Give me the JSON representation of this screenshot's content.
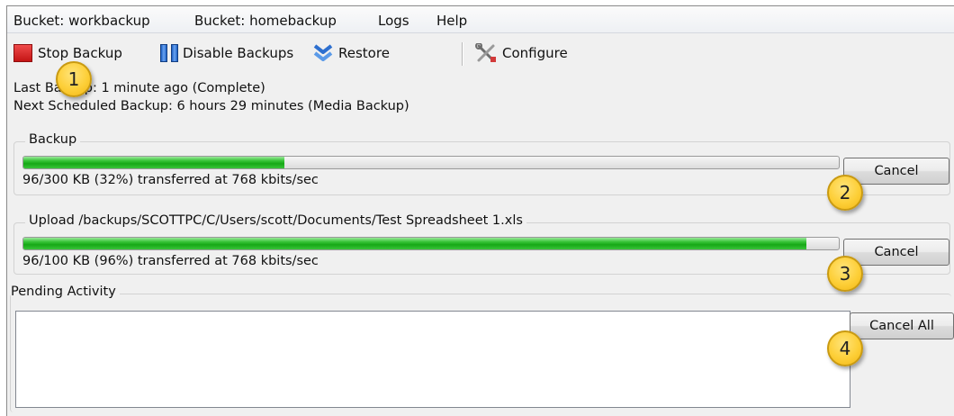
{
  "menu": [
    {
      "label": "Bucket: workbackup"
    },
    {
      "label": "Bucket: homebackup"
    },
    {
      "label": "Logs"
    },
    {
      "label": "Help"
    }
  ],
  "toolbar": {
    "stop_backup": "Stop Backup",
    "disable_backups": "Disable Backups",
    "restore": "Restore",
    "configure": "Configure"
  },
  "status": {
    "last_backup": "Last Backup: 1 minute ago (Complete)",
    "next_backup": "Next Scheduled Backup: 6 hours 29 minutes (Media Backup)"
  },
  "backup": {
    "title": "Backup",
    "progress_percent": 32,
    "transfer_text": "96/300 KB (32%) transferred at 768 kbits/sec",
    "cancel_label": "Cancel"
  },
  "upload": {
    "title": "Upload /backups/SCOTTPC/C/Users/scott/Documents/Test Spreadsheet 1.xls",
    "progress_percent": 96,
    "transfer_text": "96/100 KB (96%) transferred at 768 kbits/sec",
    "cancel_label": "Cancel"
  },
  "pending": {
    "title": "Pending Activity",
    "items": [],
    "cancel_all_label": "Cancel All"
  },
  "markers": [
    "1",
    "2",
    "3",
    "4"
  ],
  "colors": {
    "progress_green": "#16a816",
    "marker_yellow": "#fdcf38",
    "stop_red": "#d81e1e",
    "disable_blue": "#2f74d6",
    "restore_blue": "#3a7bd5"
  },
  "icons": {
    "stop": "stop-square-icon",
    "disable": "pause-bars-icon",
    "restore": "double-chevron-down-icon",
    "configure": "tools-icon"
  }
}
